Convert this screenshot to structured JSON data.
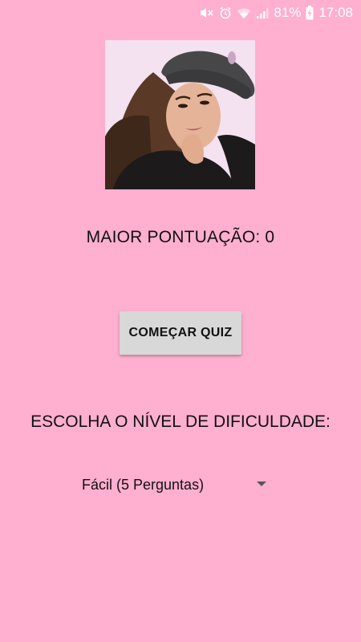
{
  "status_bar": {
    "battery_percent": "81%",
    "time": "17:08",
    "icons": [
      "mute-icon",
      "alarm-icon",
      "wifi-icon",
      "signal-icon",
      "battery-charging-icon"
    ]
  },
  "profile": {
    "image": "profile-photo"
  },
  "score": {
    "label": "MAIOR PONTUAÇÃO: 0"
  },
  "actions": {
    "start_label": "COMEÇAR QUIZ"
  },
  "difficulty": {
    "title": "ESCOLHA O NÍVEL DE DIFICULDADE:",
    "selected": "Fácil (5 Perguntas)"
  },
  "colors": {
    "background": "#ffafcf",
    "button": "#d8d8d8"
  }
}
